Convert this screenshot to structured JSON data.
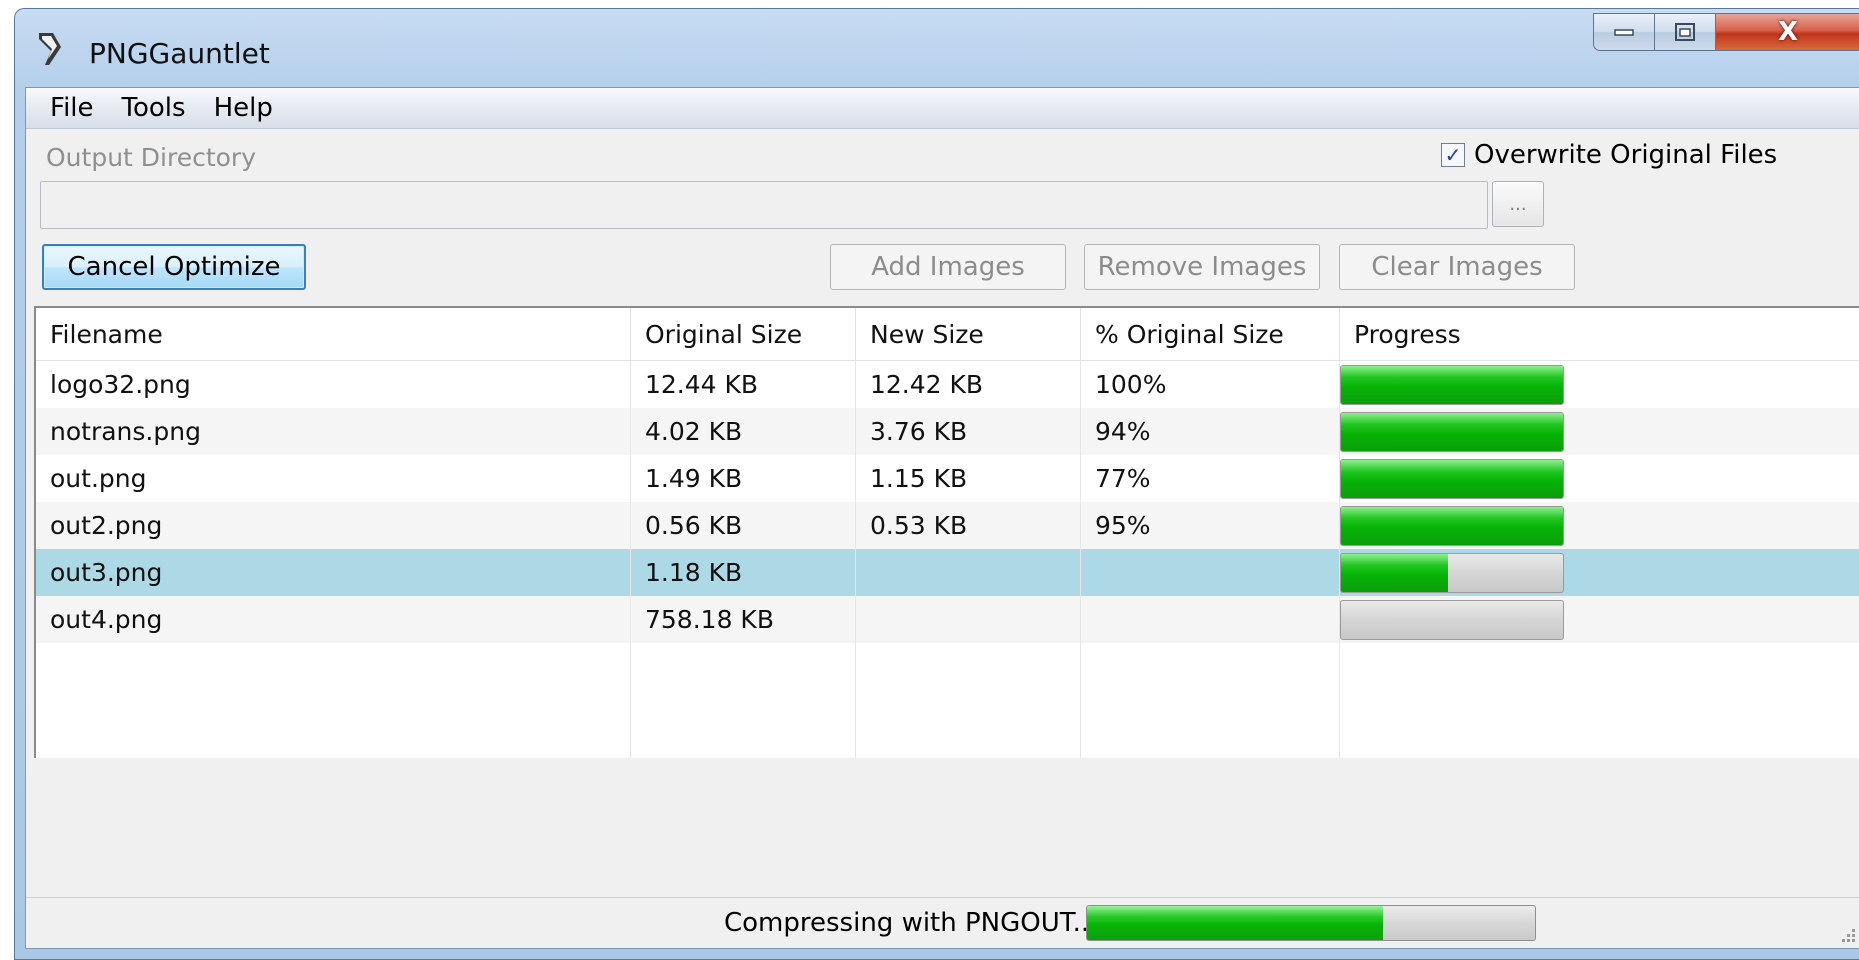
{
  "window": {
    "title": "PNGGauntlet",
    "controls": {
      "close_glyph": "X"
    }
  },
  "menu": [
    "File",
    "Tools",
    "Help"
  ],
  "options": {
    "output_directory_label": "Output Directory",
    "output_directory_value": "",
    "browse_label": "...",
    "overwrite_label": "Overwrite Original Files",
    "overwrite_checked": true,
    "check_glyph": "✓"
  },
  "buttons": {
    "cancel_optimize": "Cancel Optimize",
    "add_images": "Add Images",
    "remove_images": "Remove Images",
    "clear_images": "Clear Images"
  },
  "table": {
    "columns": [
      "Filename",
      "Original Size",
      "New Size",
      "% Original Size",
      "Progress"
    ],
    "rows": [
      {
        "filename": "logo32.png",
        "original": "12.44 KB",
        "new": "12.42 KB",
        "percent": "100%",
        "progress": 1.0
      },
      {
        "filename": "notrans.png",
        "original": "4.02 KB",
        "new": "3.76 KB",
        "percent": "94%",
        "progress": 1.0
      },
      {
        "filename": "out.png",
        "original": "1.49 KB",
        "new": "1.15 KB",
        "percent": "77%",
        "progress": 1.0
      },
      {
        "filename": "out2.png",
        "original": "0.56 KB",
        "new": "0.53 KB",
        "percent": "95%",
        "progress": 1.0
      },
      {
        "filename": "out3.png",
        "original": "1.18 KB",
        "new": "",
        "percent": "",
        "progress": 0.48
      },
      {
        "filename": "out4.png",
        "original": "758.18 KB",
        "new": "",
        "percent": "",
        "progress": 0.0
      }
    ],
    "selected_index": 4
  },
  "status": {
    "text": "Compressing with PNGOUT...",
    "progress": 0.66
  },
  "colors": {
    "progress_green": "#06b306",
    "selection": "#add8e6",
    "close_red": "#c0351d"
  },
  "icons": {
    "app": "pen-nib-icon",
    "minimize": "minimize-icon",
    "maximize": "maximize-icon",
    "close": "close-icon",
    "checkbox": "checkmark-icon",
    "grip": "resize-grip-icon"
  }
}
